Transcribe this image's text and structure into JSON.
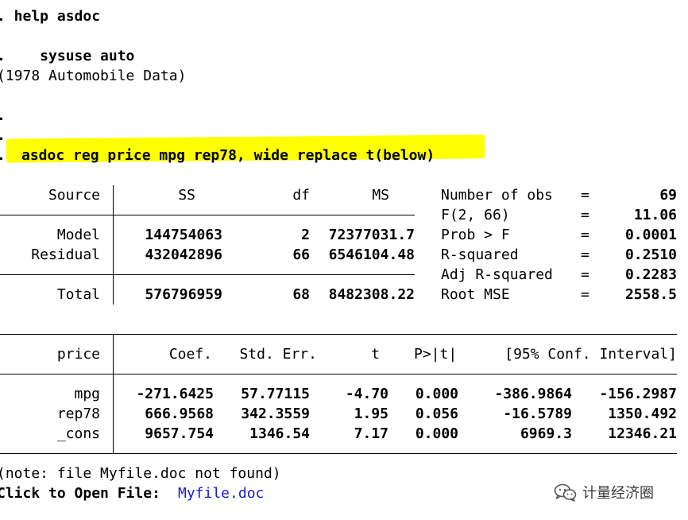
{
  "console": {
    "cmd_help": ". help asdoc",
    "cmd_sysuse": ".    sysuse auto",
    "dataset_label": "(1978 Automobile Data)",
    "blank_prompt_1": ".",
    "blank_prompt_2": ".",
    "prompt_dot": ".",
    "cmd_asdoc": "asdoc reg price mpg rep78, wide replace t(below)"
  },
  "anova": {
    "headers": {
      "source": "Source",
      "ss": "SS",
      "df": "df",
      "ms": "MS"
    },
    "rows": [
      {
        "source": "Model",
        "ss": "144754063",
        "df": "2",
        "ms": "72377031.7"
      },
      {
        "source": "Residual",
        "ss": "432042896",
        "df": "66",
        "ms": "6546104.48"
      }
    ],
    "total": {
      "source": "Total",
      "ss": "576796959",
      "df": "68",
      "ms": "8482308.22"
    }
  },
  "stats": [
    {
      "label": "Number of obs",
      "eq": "=",
      "value": "69"
    },
    {
      "label": "F(2, 66)",
      "eq": "=",
      "value": "11.06"
    },
    {
      "label": "Prob > F",
      "eq": "=",
      "value": "0.0001"
    },
    {
      "label": "R-squared",
      "eq": "=",
      "value": "0.2510"
    },
    {
      "label": "Adj R-squared",
      "eq": "=",
      "value": "0.2283"
    },
    {
      "label": "Root MSE",
      "eq": "=",
      "value": "2558.5"
    }
  ],
  "coef_table": {
    "headers": {
      "depvar": "price",
      "coef": "Coef.",
      "se": "Std. Err.",
      "t": "t",
      "p": "P>|t|",
      "ci": "[95% Conf. Interval]"
    },
    "rows": [
      {
        "var": "mpg",
        "coef": "-271.6425",
        "se": "57.77115",
        "t": "-4.70",
        "p": "0.000",
        "lo": "-386.9864",
        "hi": "-156.2987"
      },
      {
        "var": "rep78",
        "coef": "666.9568",
        "se": "342.3559",
        "t": "1.95",
        "p": "0.056",
        "lo": "-16.5789",
        "hi": "1350.492"
      },
      {
        "var": "_cons",
        "coef": "9657.754",
        "se": "1346.54",
        "t": "7.17",
        "p": "0.000",
        "lo": "6969.3",
        "hi": "12346.21"
      }
    ]
  },
  "footer": {
    "note": "(note: file Myfile.doc not found)",
    "click_label": "Click to Open File:",
    "file_link": "Myfile.doc"
  },
  "watermark": {
    "text": "计量经济圈",
    "icon": "wechat-icon"
  }
}
